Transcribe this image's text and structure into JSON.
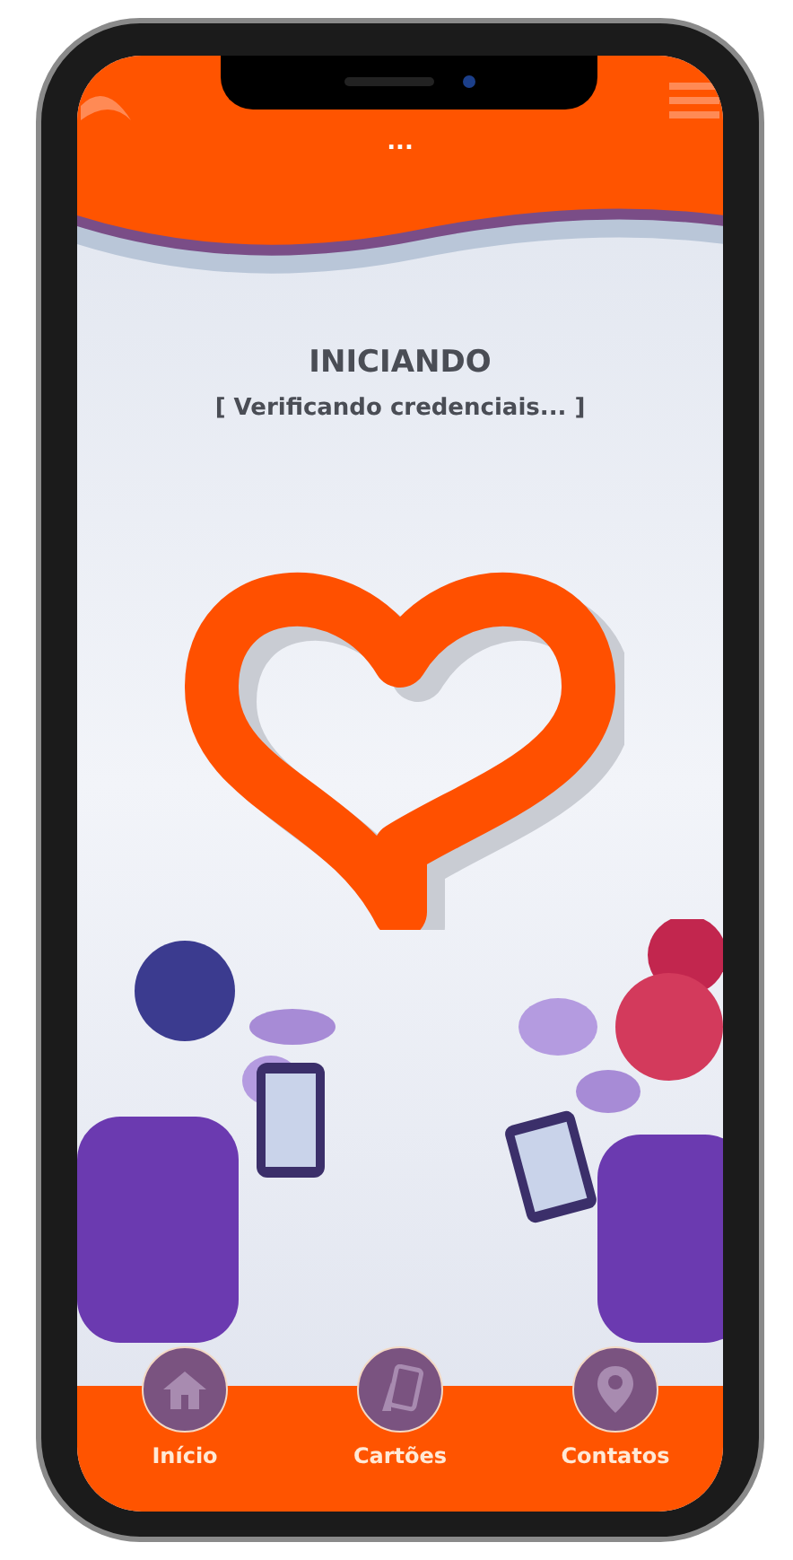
{
  "header": {
    "dots": "..."
  },
  "status": {
    "title": "INICIANDO",
    "message": "[ Verificando credenciais... ]"
  },
  "nav": [
    {
      "label": "Início",
      "kind": "home"
    },
    {
      "label": "Cartões",
      "kind": "cards"
    },
    {
      "label": "Contatos",
      "kind": "location"
    }
  ]
}
